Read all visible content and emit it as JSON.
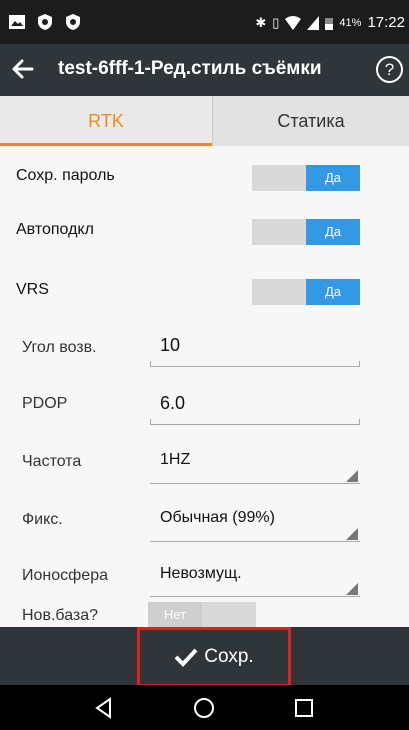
{
  "status_bar": {
    "battery": "41%",
    "time": "17:22",
    "icons": [
      "image-icon",
      "shield-icon",
      "shield-icon",
      "bluetooth-icon",
      "vibrate-icon",
      "wifi-icon",
      "signal-icon",
      "battery-icon"
    ]
  },
  "toolbar": {
    "title": "test-6fff-1-Ред.стиль съёмки",
    "help_label": "?"
  },
  "tabs": [
    {
      "label": "RTK",
      "active": true
    },
    {
      "label": "Статика",
      "active": false
    }
  ],
  "toggles": [
    {
      "label": "Сохр. пароль",
      "value": "Да",
      "on": true
    },
    {
      "label": "Автоподкл",
      "value": "Да",
      "on": true
    },
    {
      "label": "VRS",
      "value": "Да",
      "on": true
    }
  ],
  "fields": [
    {
      "label": "Угол возв.",
      "value": "10",
      "kind": "input"
    },
    {
      "label": "PDOP",
      "value": "6.0",
      "kind": "input"
    },
    {
      "label": "Частота",
      "value": "1HZ",
      "kind": "select"
    },
    {
      "label": "Фикс.",
      "value": "Обычная (99%)",
      "kind": "select"
    },
    {
      "label": "Ионосфера",
      "value": "Невозмущ.",
      "kind": "select"
    }
  ],
  "new_base": {
    "label": "Нов.база?",
    "value": "Нет",
    "on": false
  },
  "save_button": {
    "label": "Сохр."
  },
  "colors": {
    "accent": "#f08a1c",
    "switch_on": "#3399e5",
    "toolbar": "#2f3538",
    "highlight": "#e01f1f"
  }
}
